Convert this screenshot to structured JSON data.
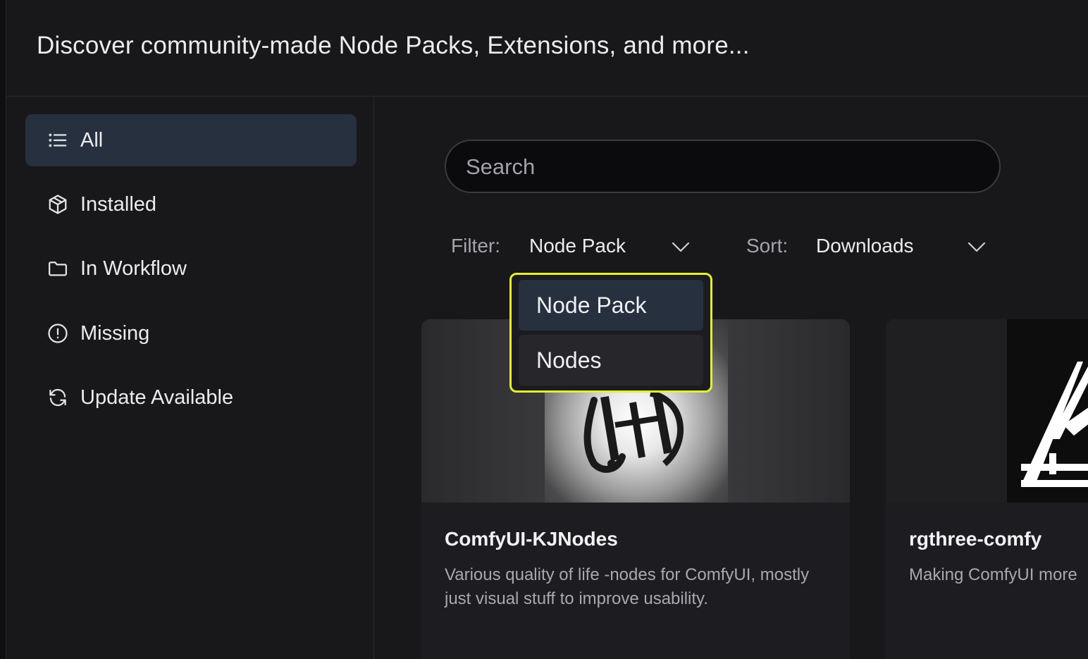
{
  "header": {
    "title": "Discover community-made Node Packs, Extensions, and more..."
  },
  "sidebar": {
    "items": [
      {
        "label": "All",
        "icon": "list-icon",
        "active": true
      },
      {
        "label": "Installed",
        "icon": "cube-icon",
        "active": false
      },
      {
        "label": "In Workflow",
        "icon": "folder-icon",
        "active": false
      },
      {
        "label": "Missing",
        "icon": "alert-circle-icon",
        "active": false
      },
      {
        "label": "Update Available",
        "icon": "refresh-icon",
        "active": false
      }
    ]
  },
  "search": {
    "placeholder": "Search",
    "value": ""
  },
  "filter": {
    "label": "Filter:",
    "selected": "Node Pack",
    "options": [
      "Node Pack",
      "Nodes"
    ]
  },
  "sort": {
    "label": "Sort:",
    "selected": "Downloads"
  },
  "cards": [
    {
      "title": "ComfyUI-KJNodes",
      "description": "Various quality of life -nodes for ComfyUI, mostly just visual stuff to improve usability."
    },
    {
      "title": "rgthree-comfy",
      "description": "Making ComfyUI more"
    }
  ],
  "colors": {
    "background": "#18181b",
    "active_item": "#27303f",
    "dropdown_highlight_border": "#e4f02e",
    "muted_text": "#a4a4ab"
  }
}
